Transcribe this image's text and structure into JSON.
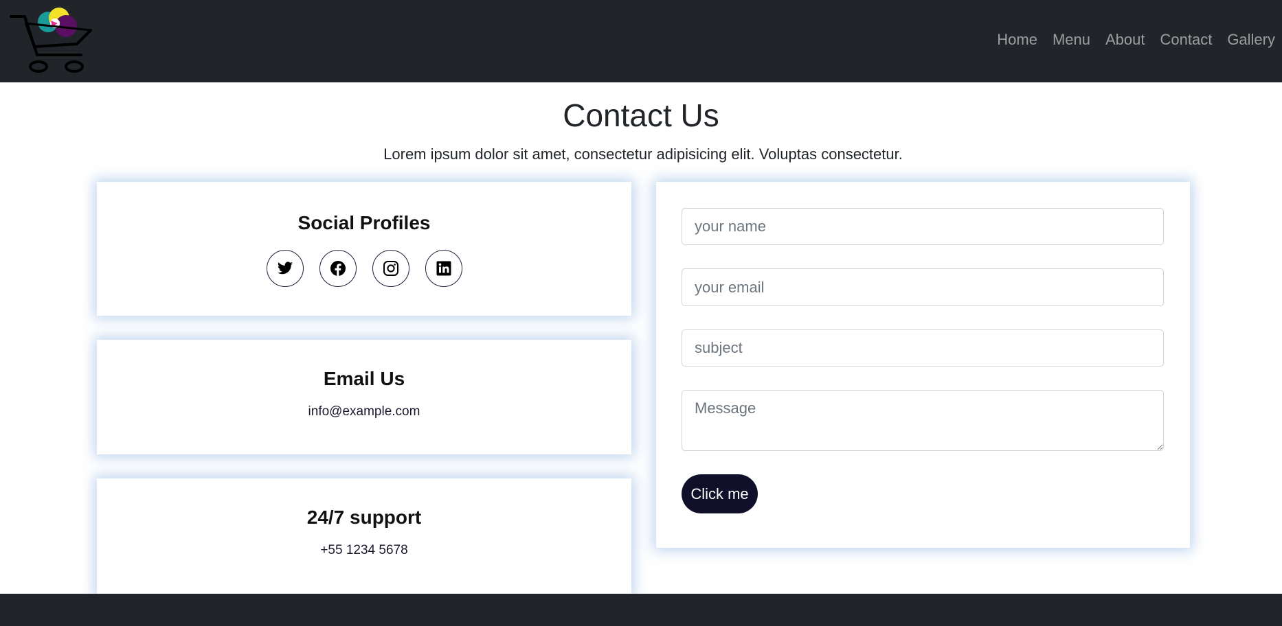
{
  "nav": {
    "logo": "shopping-cart-logo",
    "links": [
      "Home",
      "Menu",
      "About",
      "Contact",
      "Gallery"
    ]
  },
  "header": {
    "title": "Contact Us",
    "subtitle": "Lorem ipsum dolor sit amet, consectetur adipisicing elit. Voluptas consectetur."
  },
  "social": {
    "heading": "Social Profiles",
    "icons": [
      "twitter-icon",
      "facebook-icon",
      "instagram-icon",
      "linkedin-icon"
    ]
  },
  "email": {
    "heading": "Email Us",
    "address": "info@example.com"
  },
  "support": {
    "heading": "24/7 support",
    "phone": "+55 1234 5678"
  },
  "form": {
    "name_placeholder": "your name",
    "email_placeholder": "your email",
    "subject_placeholder": "subject",
    "message_placeholder": "Message",
    "submit_label": "Click me"
  },
  "colors": {
    "navbar": "#212529",
    "button": "#10102a",
    "card_shadow": "#89b0e0"
  }
}
